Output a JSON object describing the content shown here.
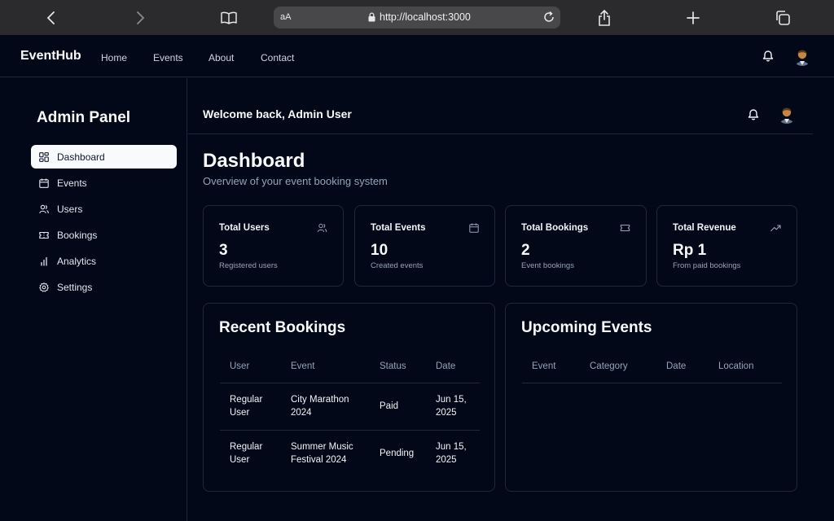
{
  "browser": {
    "text_size_label": "aA",
    "url": "http://localhost:3000"
  },
  "navbar": {
    "brand": "EventHub",
    "links": [
      "Home",
      "Events",
      "About",
      "Contact"
    ]
  },
  "sidebar": {
    "title": "Admin Panel",
    "items": [
      {
        "label": "Dashboard",
        "icon": "dashboard-icon",
        "active": true
      },
      {
        "label": "Events",
        "icon": "calendar-icon",
        "active": false
      },
      {
        "label": "Users",
        "icon": "users-icon",
        "active": false
      },
      {
        "label": "Bookings",
        "icon": "ticket-icon",
        "active": false
      },
      {
        "label": "Analytics",
        "icon": "bar-chart-icon",
        "active": false
      },
      {
        "label": "Settings",
        "icon": "gear-icon",
        "active": false
      }
    ]
  },
  "header": {
    "welcome": "Welcome back, Admin User"
  },
  "page": {
    "title": "Dashboard",
    "subtitle": "Overview of your event booking system"
  },
  "stats": [
    {
      "label": "Total Users",
      "value": "3",
      "desc": "Registered users",
      "icon": "users-icon"
    },
    {
      "label": "Total Events",
      "value": "10",
      "desc": "Created events",
      "icon": "calendar-icon"
    },
    {
      "label": "Total Bookings",
      "value": "2",
      "desc": "Event bookings",
      "icon": "ticket-icon"
    },
    {
      "label": "Total Revenue",
      "value": "Rp 1",
      "desc": "From paid bookings",
      "icon": "trending-up-icon"
    }
  ],
  "recent_bookings": {
    "title": "Recent Bookings",
    "columns": [
      "User",
      "Event",
      "Status",
      "Date"
    ],
    "rows": [
      {
        "user": "Regular User",
        "event": "City Marathon 2024",
        "status": "Paid",
        "date": "Jun 15, 2025"
      },
      {
        "user": "Regular User",
        "event": "Summer Music Festival 2024",
        "status": "Pending",
        "date": "Jun 15, 2025"
      }
    ]
  },
  "upcoming_events": {
    "title": "Upcoming Events",
    "columns": [
      "Event",
      "Category",
      "Date",
      "Location"
    ]
  },
  "colors": {
    "background": "#020817",
    "border": "#1e293b",
    "muted_text": "#94a3b8",
    "active_item_bg": "#f8fafc"
  }
}
